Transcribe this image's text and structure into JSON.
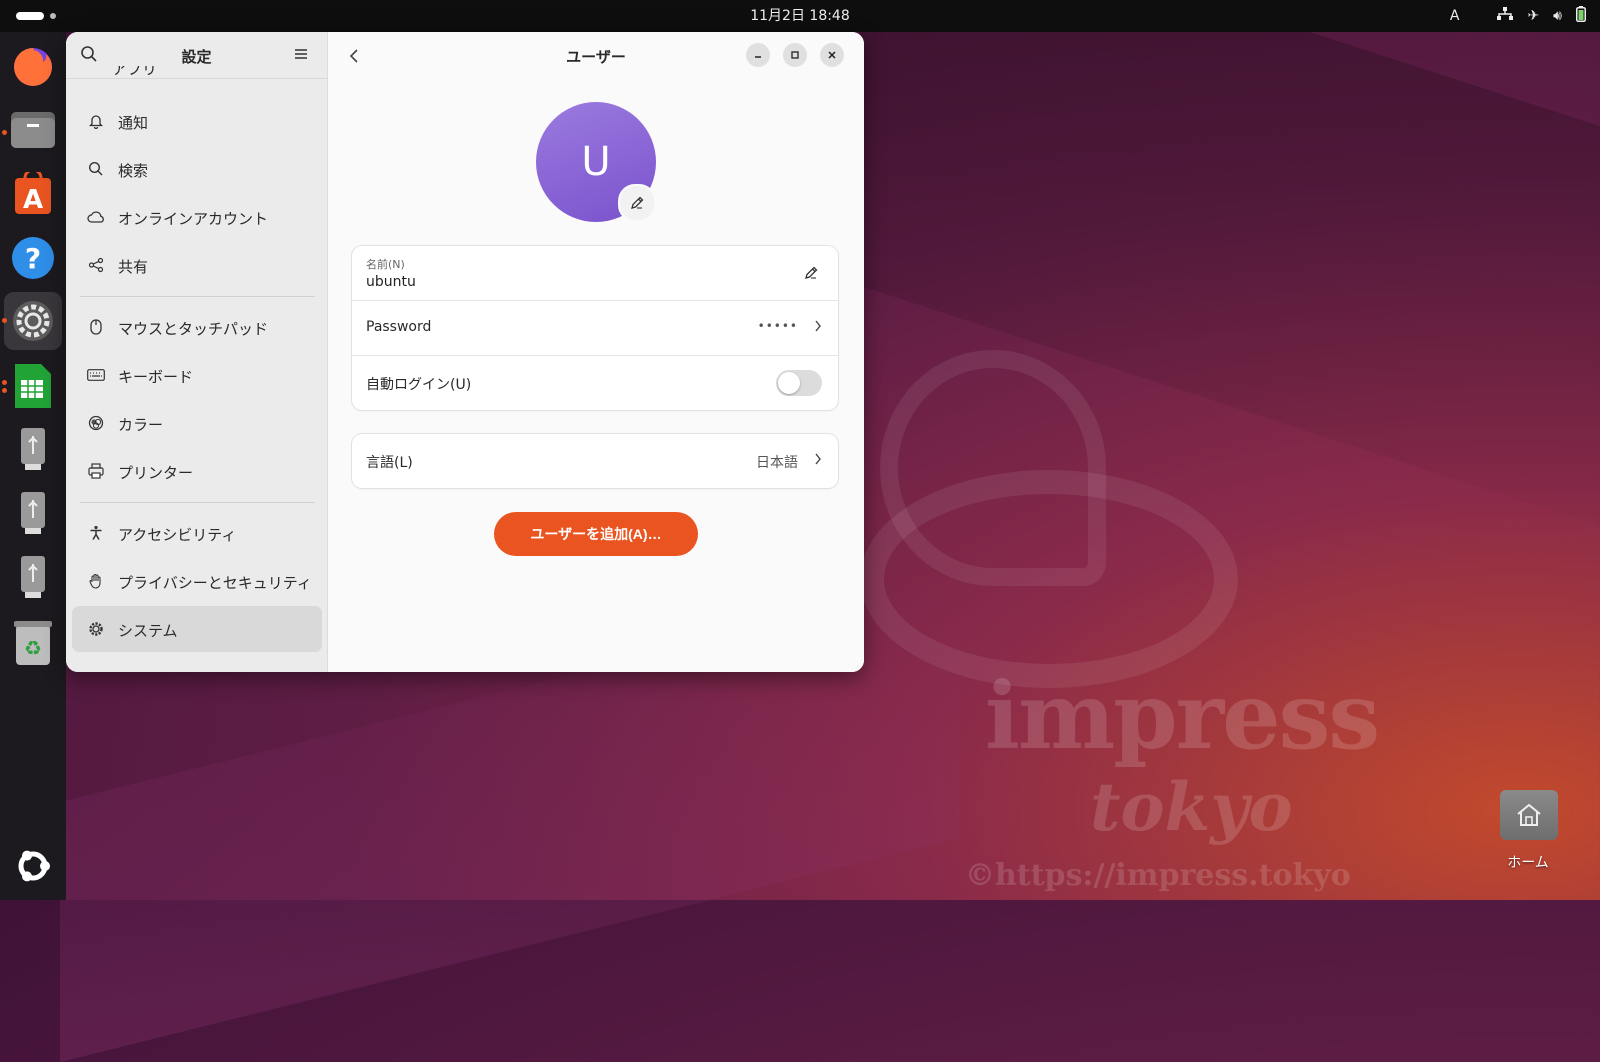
{
  "topbar": {
    "clock": "11月2日  18:48",
    "input_method": "A",
    "tray_icons": [
      "network-icon",
      "airplane-icon",
      "volume-icon",
      "battery-icon"
    ]
  },
  "dock": {
    "items": [
      "firefox-icon",
      "files-icon",
      "app-center-icon",
      "help-icon",
      "settings-icon",
      "spreadsheet-icon",
      "usb-drive-icon",
      "usb-drive-icon",
      "usb-drive-icon",
      "trash-icon"
    ],
    "show_apps": "ubuntu-logo-icon"
  },
  "settings": {
    "sidebar_title": "設定",
    "sidebar_items": [
      {
        "label": "通知",
        "icon": "bell-icon"
      },
      {
        "label": "検索",
        "icon": "search-icon"
      },
      {
        "label": "オンラインアカウント",
        "icon": "cloud-icon"
      },
      {
        "label": "共有",
        "icon": "share-icon"
      },
      {
        "label": "マウスとタッチパッド",
        "icon": "mouse-icon"
      },
      {
        "label": "キーボード",
        "icon": "keyboard-icon"
      },
      {
        "label": "カラー",
        "icon": "color-icon"
      },
      {
        "label": "プリンター",
        "icon": "printer-icon"
      },
      {
        "label": "アクセシビリティ",
        "icon": "accessibility-icon"
      },
      {
        "label": "プライバシーとセキュリティ",
        "icon": "hand-icon"
      },
      {
        "label": "システム",
        "icon": "gear-icon",
        "selected": true
      }
    ],
    "partial_item": "アプリ"
  },
  "users": {
    "title": "ユーザー",
    "avatar_letter": "U",
    "name_label": "名前(N)",
    "name_value": "ubuntu",
    "password_label": "Password",
    "password_value": "•••••",
    "autologin_label": "自動ログイン(U)",
    "autologin_on": false,
    "language_label": "言語(L)",
    "language_value": "日本語",
    "add_user_button": "ユーザーを追加(A)…"
  },
  "desktop": {
    "home_label": "ホーム",
    "watermark_main": "impress",
    "watermark_sub": "tokyo",
    "watermark_url": "©https://impress.tokyo"
  },
  "colors": {
    "accent": "#e95420",
    "avatar": "#8a63d6"
  }
}
